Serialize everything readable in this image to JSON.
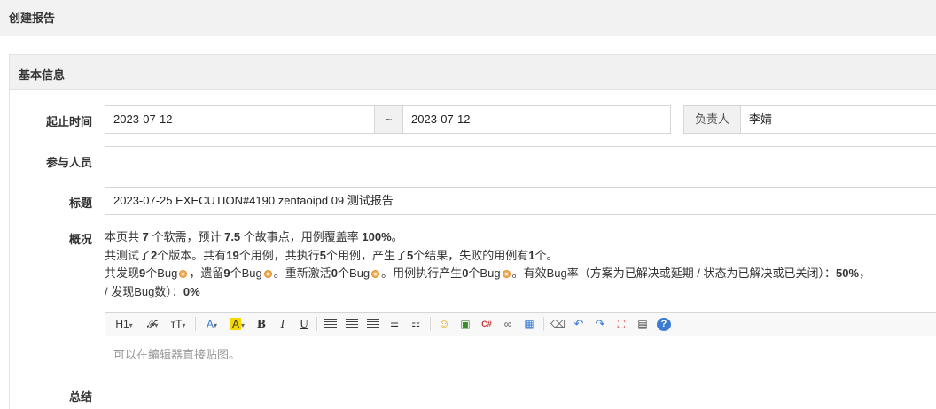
{
  "page": {
    "title": "创建报告"
  },
  "panel": {
    "title": "基本信息"
  },
  "form": {
    "date_label": "起止时间",
    "start_date": "2023-07-12",
    "date_sep": "~",
    "end_date": "2023-07-12",
    "owner_addon": "负责人",
    "owner_value": "李婧",
    "members_label": "参与人员",
    "members_value": "",
    "title_label": "标题",
    "title_value": "2023-07-25 EXECUTION#4190 zentaoipd 09 测试报告",
    "overview_label": "概况",
    "summary_label": "总结"
  },
  "overview": {
    "l1_a": "本页共 ",
    "l1_b": "7",
    "l1_c": " 个软需，预计 ",
    "l1_d": "7.5",
    "l1_e": " 个故事点，用例覆盖率 ",
    "l1_f": "100%",
    "l1_g": "。",
    "l2_a": "共测试了",
    "l2_b": "2",
    "l2_c": "个版本。共有",
    "l2_d": "19",
    "l2_e": "个用例，共执行",
    "l2_f": "5",
    "l2_g": "个用例，产生了",
    "l2_h": "5",
    "l2_i": "个结果，失败的用例有",
    "l2_j": "1",
    "l2_k": "个。",
    "l3_a": "共发现",
    "l3_b": "9",
    "l3_c": "个Bug",
    "l3_d": "，遗留",
    "l3_e": "9",
    "l3_f": "个Bug",
    "l3_g": "。重新激活",
    "l3_h": "0",
    "l3_i": "个Bug",
    "l3_j": "。用例执行产生",
    "l3_k": "0",
    "l3_l": "个Bug",
    "l3_m": "。有效Bug率（方案为已解决或延期 / 状态为已解决或已关闭）：",
    "l3_n": "50%",
    "l3_o": "，",
    "l4_a": "/ 发现Bug数）：",
    "l4_b": "0%"
  },
  "editor": {
    "placeholder": "可以在编辑器直接贴图。",
    "toolbar": {
      "heading": "H1",
      "font_family": "𝓕",
      "font_size": "тT",
      "font_color": "A",
      "highlight": "A",
      "bold": "B",
      "italic": "I",
      "underline": "U"
    }
  }
}
